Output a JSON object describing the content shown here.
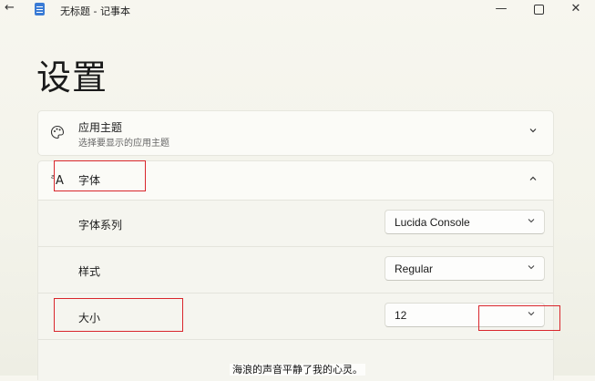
{
  "window": {
    "back_glyph": "←",
    "title": "无标题 - 记事本",
    "minimize_glyph": "—",
    "close_glyph": "✕"
  },
  "page": {
    "heading": "设置"
  },
  "theme_card": {
    "icon": "palette-icon",
    "title": "应用主题",
    "subtitle": "选择要显示的应用主题"
  },
  "font_card": {
    "icon": "font-icon",
    "title": "字体",
    "family": {
      "label": "字体系列",
      "value": "Lucida Console"
    },
    "style": {
      "label": "样式",
      "value": "Regular"
    },
    "size": {
      "label": "大小",
      "value": "12"
    }
  },
  "caption": "海浪的声音平静了我的心灵。",
  "colors": {
    "highlight": "#d9262c",
    "accent": "#3a7bd5"
  }
}
